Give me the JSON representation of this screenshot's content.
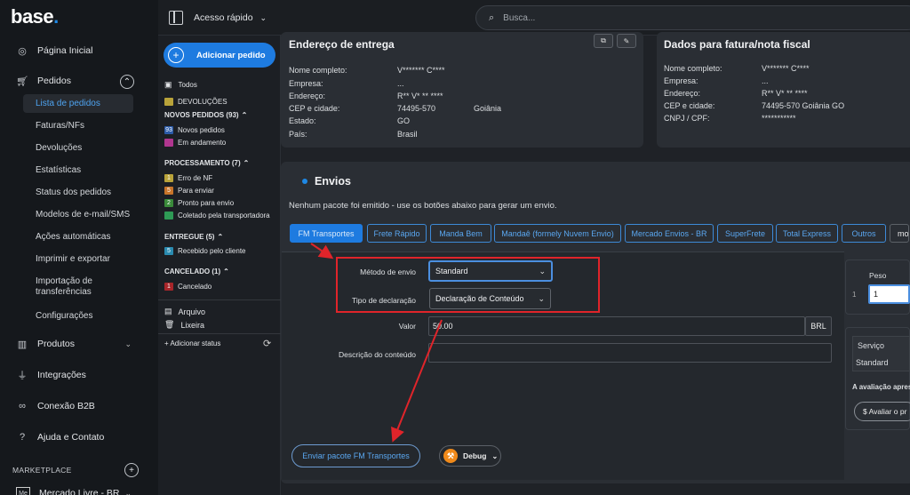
{
  "nav": {
    "logo": "base",
    "items": [
      {
        "label": "Página Inicial",
        "icon": "home-icon"
      },
      {
        "label": "Pedidos",
        "icon": "cart-icon"
      },
      {
        "label": "Produtos",
        "icon": "chart-icon"
      },
      {
        "label": "Integrações",
        "icon": "plug-icon"
      },
      {
        "label": "Conexão B2B",
        "icon": "link-icon"
      },
      {
        "label": "Ajuda e Contato",
        "icon": "help-icon"
      }
    ],
    "sub_items": [
      "Lista de pedidos",
      "Faturas/NFs",
      "Devoluções",
      "Estatísticas",
      "Status dos pedidos",
      "Modelos de e-mail/SMS",
      "Ações automáticas",
      "Imprimir e exportar",
      "Importação de transferências",
      "Configurações"
    ],
    "marketplace_label": "MARKETPLACE",
    "marketplace_item": "Mercado Livre - BR",
    "marketplace_badge": "Me"
  },
  "topbar": {
    "quick_access": "Acesso rápido",
    "search_placeholder": "Busca..."
  },
  "side2": {
    "add_order": "Adicionar pedido",
    "all": "Todos",
    "returns": "DEVOLUÇÕES",
    "new_orders_head": "NOVOS PEDIDOS (93)",
    "new_orders_count": "93",
    "new_orders": "Novos pedidos",
    "in_progress": "Em andamento",
    "processing_head": "PROCESSAMENTO (7)",
    "nf_error_badge": "1",
    "nf_error": "Erro de NF",
    "to_ship_badge": "5",
    "to_ship": "Para enviar",
    "ready_badge": "2",
    "ready": "Pronto para envio",
    "collected": "Coletado pela transportadora",
    "delivered_head": "ENTREGUE (5)",
    "received_badge": "5",
    "received": "Recebido pelo cliente",
    "cancelled_head": "CANCELADO (1)",
    "cancelled_badge": "1",
    "cancelled": "Cancelado",
    "archive": "Arquivo",
    "trash": "Lixeira",
    "add_status": "+ Adicionar status"
  },
  "delivery": {
    "title": "Endereço de entrega",
    "labels": [
      "Nome completo:",
      "Empresa:",
      "Endereço:",
      "CEP e cidade:",
      "Estado:",
      "País:"
    ],
    "values": [
      "V******* C****",
      "...",
      "R** V* ** ****",
      "74495-570",
      "GO",
      "Brasil"
    ],
    "city": "Goiânia"
  },
  "invoice": {
    "title": "Dados para fatura/nota fiscal",
    "labels": [
      "Nome completo:",
      "Empresa:",
      "Endereço:",
      "CEP e cidade:",
      "CNPJ / CPF:"
    ],
    "values": [
      "V******* C****",
      "...",
      "R** V* ** ****",
      "74495-570  Goiânia  GO",
      "***********"
    ]
  },
  "shipping": {
    "title": "Envios",
    "notice": "Nenhum pacote foi emitido - use os botões abaixo para gerar um envio.",
    "tabs": [
      "FM Transportes",
      "Frete Rápido",
      "Manda Bem",
      "Mandaê (formely Nuvem Envio)",
      "Mercado Envios - BR",
      "SuperFrete",
      "Total Express",
      "Outros",
      "mo"
    ],
    "method_label": "Método de envio",
    "method_value": "Standard",
    "declaration_label": "Tipo de declaração",
    "declaration_value": "Declaração de Conteúdo",
    "value_label": "Valor",
    "value": "50.00",
    "currency": "BRL",
    "description_label": "Descrição do conteúdo",
    "send_button": "Enviar pacote FM Transportes",
    "debug_button": "Debug",
    "weight_label": "Peso",
    "weight_index": "1",
    "weight_value": "1",
    "service_label": "Serviço",
    "service_value": "Standard",
    "rating_text": "A avaliação apres",
    "rate_button": "$ Avaliar o pr"
  },
  "colors": {
    "accent": "#1e7be0",
    "highlight": "#e0242a",
    "background": "#1f2227"
  }
}
